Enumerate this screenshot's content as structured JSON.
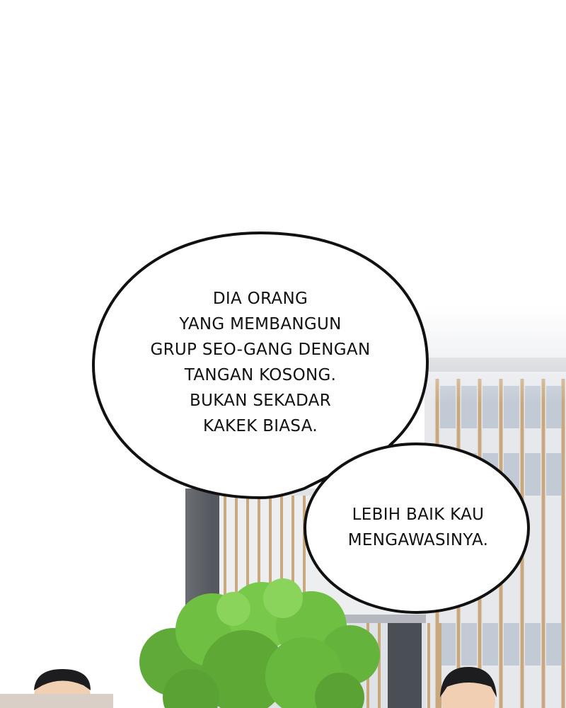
{
  "panel": {
    "bubble_1": {
      "lines": [
        "DIA ORANG",
        "YANG MEMBANGUN",
        "GRUP SEO-GANG DENGAN",
        "TANGAN KOSONG.",
        "BUKAN SEKADAR",
        "KAKEK BIASA."
      ]
    },
    "bubble_2": {
      "lines": [
        "LEBIH BAIK KAU",
        "MENGAWASINYA."
      ]
    }
  },
  "colors": {
    "sky": "#ffffff",
    "building": "#e4e6ea",
    "building_dark": "#50545c",
    "window_frame": "#c9a87e",
    "tree": "#6fbf43",
    "bubble_fill": "#ffffff",
    "bubble_outline": "#111111"
  }
}
